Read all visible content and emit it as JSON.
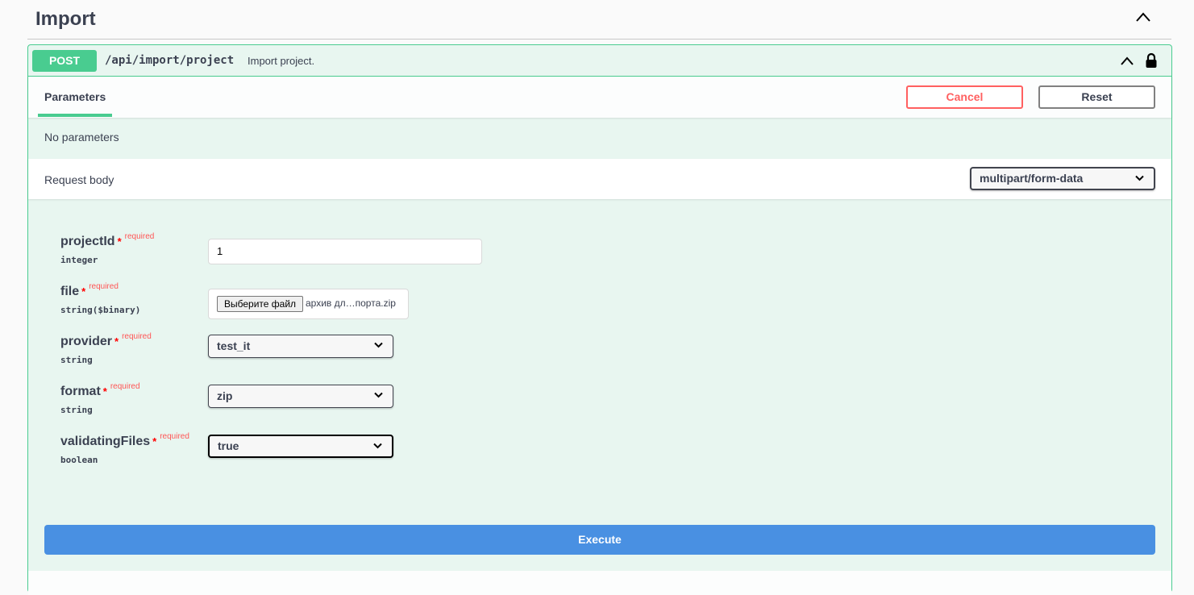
{
  "tag": {
    "title": "Import"
  },
  "operation": {
    "method": "POST",
    "path": "/api/import/project",
    "summary": "Import project.",
    "method_color": "#49cc90",
    "tabs": [
      {
        "label": "Parameters",
        "active": true
      }
    ],
    "cancel_label": "Cancel",
    "reset_label": "Reset",
    "no_params": "No parameters",
    "request_body_label": "Request body",
    "content_type": "multipart/form-data",
    "fields": [
      {
        "name": "projectId",
        "star": "*",
        "required": "required",
        "type": "integer",
        "value": "1"
      },
      {
        "name": "file",
        "star": "*",
        "required": "required",
        "type": "string($binary)",
        "button": "Выберите файл",
        "value": "архив дл…порта.zip"
      },
      {
        "name": "provider",
        "star": "*",
        "required": "required",
        "type": "string",
        "value": "test_it"
      },
      {
        "name": "format",
        "star": "*",
        "required": "required",
        "type": "string",
        "value": "zip"
      },
      {
        "name": "validatingFiles",
        "star": "*",
        "required": "required",
        "type": "boolean",
        "value": "true"
      }
    ],
    "execute_label": "Execute",
    "execute_color": "#4990e2"
  }
}
